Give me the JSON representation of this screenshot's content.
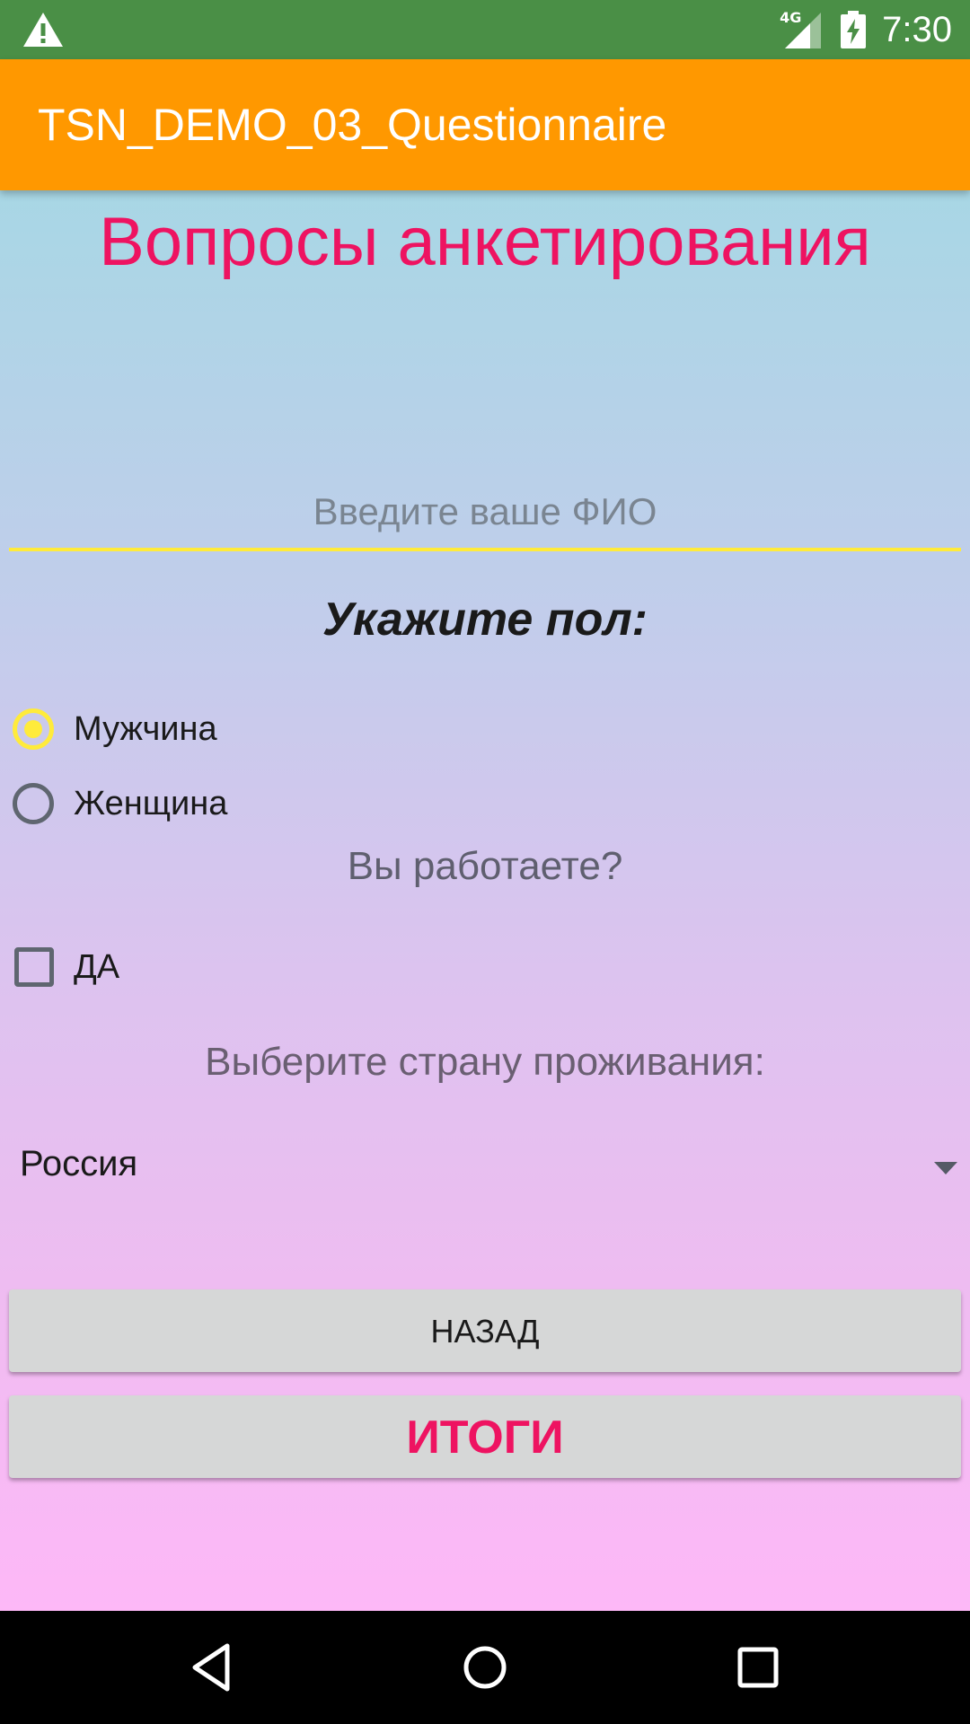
{
  "status_bar": {
    "network_type": "4G",
    "time": "7:30",
    "icons": [
      "warning-icon",
      "signal-icon",
      "battery-charging-icon"
    ]
  },
  "app_bar": {
    "title": "TSN_DEMO_03_Questionnaire"
  },
  "form": {
    "title": "Вопросы анкетирования",
    "name_input": {
      "placeholder": "Введите ваше ФИО",
      "value": ""
    },
    "gender": {
      "heading": "Укажите пол:",
      "options": [
        {
          "label": "Мужчина",
          "checked": true
        },
        {
          "label": "Женщина",
          "checked": false
        }
      ]
    },
    "work": {
      "heading": "Вы работаете?",
      "checkbox_label": "ДА",
      "checked": false
    },
    "country": {
      "heading": "Выберите страну проживания:",
      "selected": "Россия"
    },
    "buttons": {
      "back": "НАЗАД",
      "results": "ИТОГИ"
    }
  },
  "nav_bar": {
    "icons": [
      "back-icon",
      "home-icon",
      "recents-icon"
    ]
  },
  "colors": {
    "status_bar": "#4a8f46",
    "app_bar": "#ff9800",
    "title_accent": "#ee1361",
    "radio_accent": "#ffeb3b"
  }
}
